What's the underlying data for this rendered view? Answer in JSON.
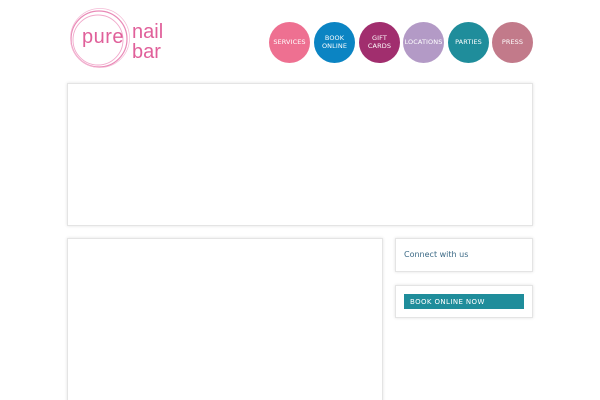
{
  "logo": {
    "word_pure": "pure",
    "word_nail": "nail",
    "word_bar": "bar",
    "color": "#e0609a"
  },
  "nav": {
    "items": [
      {
        "label": "SERVICES",
        "color": "#ee7091"
      },
      {
        "label": "BOOK ONLINE",
        "color": "#0b84c3"
      },
      {
        "label": "GIFT CARDS",
        "color": "#a12e6e"
      },
      {
        "label": "LOCATIONS",
        "color": "#b39ac6"
      },
      {
        "label": "PARTIES",
        "color": "#1f8d9b"
      },
      {
        "label": "PRESS",
        "color": "#c27a8a"
      }
    ]
  },
  "sidebar": {
    "connect_title": "Connect with us",
    "book_button_label": "BOOK ONLINE NOW",
    "book_button_color": "#1f8d9b"
  }
}
